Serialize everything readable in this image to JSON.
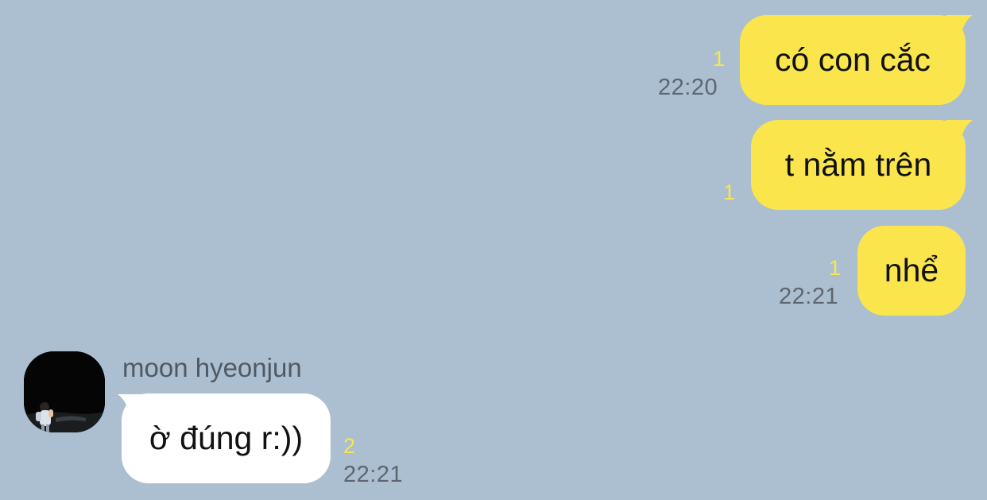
{
  "colors": {
    "background": "#ABBFD0",
    "outgoing_bubble": "#FAE64C",
    "incoming_bubble": "#FFFFFF",
    "unread_count": "#FAE64C",
    "timestamp": "#5E6670"
  },
  "messages": [
    {
      "direction": "outgoing",
      "text": "có con cắc",
      "unread": "1",
      "time": "22:20"
    },
    {
      "direction": "outgoing",
      "text": "t nằm trên",
      "unread": "1",
      "time": ""
    },
    {
      "direction": "outgoing",
      "text": "nhể",
      "unread": "1",
      "time": "22:21"
    },
    {
      "direction": "incoming",
      "sender": "moon hyeonjun",
      "avatar_icon": "profile-photo-icon",
      "text": "ờ đúng r:))",
      "unread": "2",
      "time": "22:21"
    }
  ]
}
